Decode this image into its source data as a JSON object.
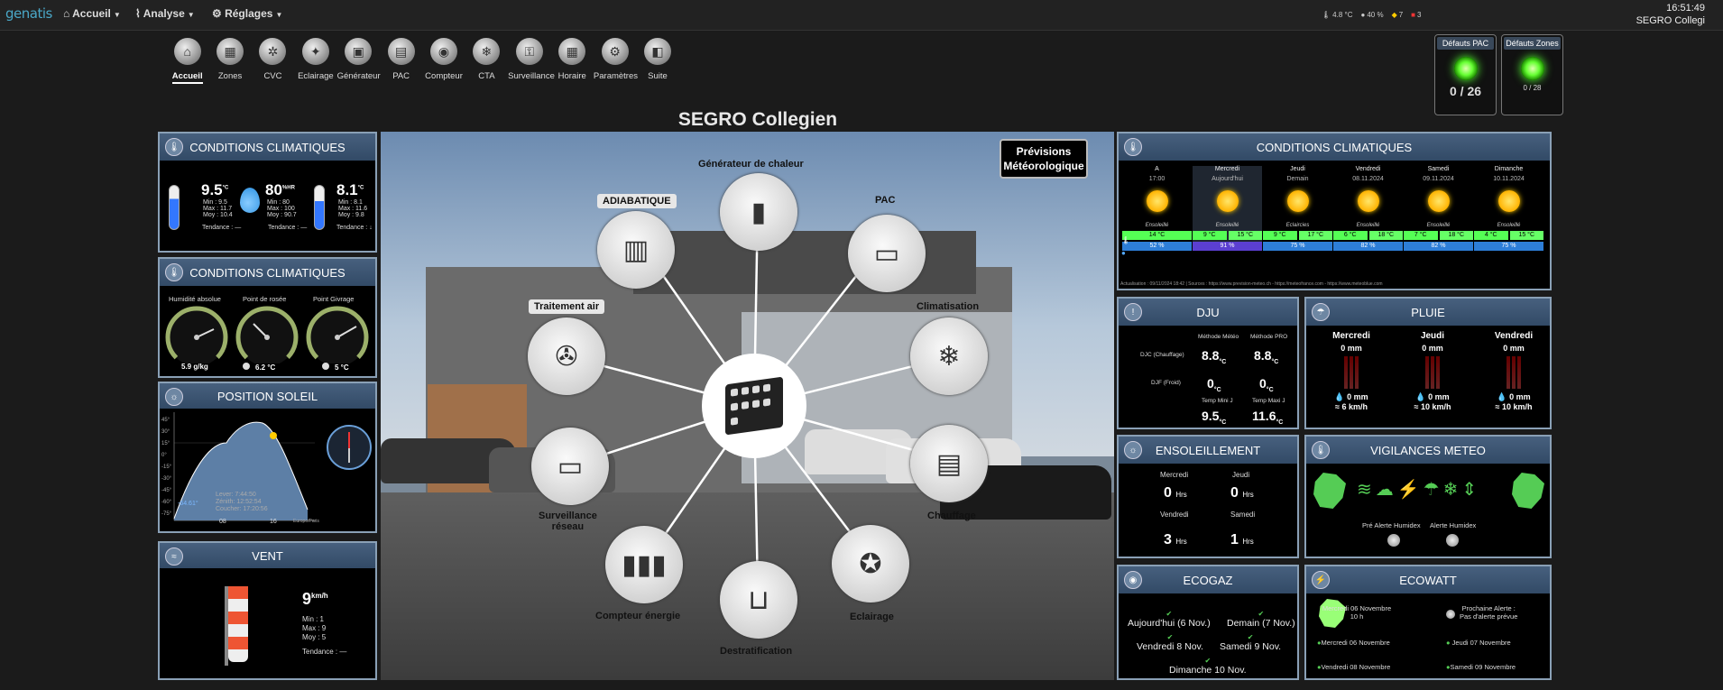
{
  "nav": {
    "logo": "genatis",
    "menu_accueil": "Accueil",
    "menu_analyse": "Analyse",
    "menu_reglages": "Réglages",
    "status_temp": "4.8 °C",
    "status_hum": "40 %",
    "status_alert": "7",
    "status_alarm": "3",
    "time": "16:51:49",
    "site": "SEGRO Collegi"
  },
  "toolbar": [
    {
      "label": "Accueil",
      "icon": "home-icon",
      "glyph": "⌂",
      "active": true
    },
    {
      "label": "Zones",
      "icon": "zones-icon",
      "glyph": "▦"
    },
    {
      "label": "CVC",
      "icon": "hvac-icon",
      "glyph": "✲"
    },
    {
      "label": "Eclairage",
      "icon": "bulb-icon",
      "glyph": "✦"
    },
    {
      "label": "Générateur",
      "icon": "generator-icon",
      "glyph": "▣"
    },
    {
      "label": "PAC",
      "icon": "heatpump-icon",
      "glyph": "▤"
    },
    {
      "label": "Compteur",
      "icon": "meter-icon",
      "glyph": "◉"
    },
    {
      "label": "CTA",
      "icon": "snowflake-icon",
      "glyph": "❄"
    },
    {
      "label": "Surveillance",
      "icon": "lock-icon",
      "glyph": "⚿"
    },
    {
      "label": "Horaire",
      "icon": "calendar-icon",
      "glyph": "▦"
    },
    {
      "label": "Paramètres",
      "icon": "gears-icon",
      "glyph": "⚙"
    },
    {
      "label": "Suite",
      "icon": "box-icon",
      "glyph": "◧"
    }
  ],
  "alarms": {
    "pac_title": "Défauts PAC",
    "pac_value": "0 / 26",
    "zones_title": "Défauts Zones",
    "zones_value": "0 / 28"
  },
  "page_title": "SEGRO Collegien",
  "climate1": {
    "title": "CONDITIONS CLIMATIQUES",
    "temp_in": "9.5",
    "temp_in_unit": "°C",
    "temp_in_min": "Min : 9.5",
    "temp_in_max": "Max : 11.7",
    "temp_in_moy": "Moy : 10.4",
    "hum": "80",
    "hum_unit": "%HR",
    "hum_min": "Min : 80",
    "hum_max": "Max : 100",
    "hum_moy": "Moy : 90.7",
    "temp_out": "8.1",
    "temp_out_unit": "°C",
    "temp_out_min": "Min : 8.1",
    "temp_out_max": "Max : 11.6",
    "temp_out_moy": "Moy : 9.8",
    "trend_in": "Tendance : —",
    "trend_hum": "Tendance : —",
    "trend_out": "Tendance : ↓"
  },
  "climate2": {
    "title": "CONDITIONS CLIMATIQUES",
    "g1_label": "Humidité absolue",
    "g1_value": "5.9 g/kg",
    "g2_label": "Point de rosée",
    "g2_value": "6.2 °C",
    "g3_label": "Point Givrage",
    "g3_value": "5 °C"
  },
  "sun": {
    "title": "POSITION SOLEIL",
    "lever": "Lever: 7:44:50",
    "zenith": "Zénith: 12:52:54",
    "coucher": "Coucher: 17:20:56",
    "angle": "-64.61°",
    "x1": "08",
    "x2": "16",
    "tz": "Europe/Paris",
    "y_labels": [
      "45°",
      "30°",
      "15°",
      "0°",
      "-15°",
      "-30°",
      "-45°",
      "-60°",
      "-75°"
    ]
  },
  "wind": {
    "title": "VENT",
    "speed": "9",
    "unit": "km/h",
    "min": "Min : 1",
    "max": "Max : 9",
    "moy": "Moy : 5",
    "trend": "Tendance : —"
  },
  "hero": {
    "forecast_label_1": "Prévisions",
    "forecast_label_2": "Météorologique",
    "nodes": {
      "generateur": "Générateur de chaleur",
      "adiabatique": "ADIABATIQUE",
      "pac": "PAC",
      "traitement": "Traitement air",
      "climatisation": "Climatisation",
      "chauffage": "Chauffage",
      "surveillance1": "Surveillance",
      "surveillance2": "réseau",
      "compteur": "Compteur énergie",
      "destrat": "Destratification",
      "eclairage": "Eclairage"
    }
  },
  "forecast": {
    "title": "CONDITIONS CLIMATIQUES",
    "source": "Actualisation : 09/11/2024 18:42 | Sources : https://www.prevision-meteo.ch - https://meteofrance.com - https://www.meteoblue.com",
    "days": [
      {
        "day": "A",
        "sub": "17:00",
        "desc": "Ensoleillé",
        "tmin": "14 °C",
        "tmax": "",
        "hum": "52 %",
        "wide": true
      },
      {
        "day": "Mercredi",
        "sub": "Aujourd'hui",
        "desc": "Ensoleillé",
        "tmin": "9 °C",
        "tmax": "15 °C",
        "hum": "91 %",
        "selected": true
      },
      {
        "day": "Jeudi",
        "sub": "Demain",
        "desc": "Eclaircies",
        "tmin": "9 °C",
        "tmax": "17 °C",
        "hum": "75 %"
      },
      {
        "day": "Vendredi",
        "sub": "08.11.2024",
        "desc": "Ensoleillé",
        "tmin": "6 °C",
        "tmax": "18 °C",
        "hum": "82 %"
      },
      {
        "day": "Samedi",
        "sub": "09.11.2024",
        "desc": "Ensoleillé",
        "tmin": "7 °C",
        "tmax": "18 °C",
        "hum": "82 %"
      },
      {
        "day": "Dimanche",
        "sub": "10.11.2024",
        "desc": "Ensoleillé",
        "tmin": "4 °C",
        "tmax": "15 °C",
        "hum": "75 %"
      }
    ]
  },
  "dju": {
    "title": "DJU",
    "col1": "Méthode Météo",
    "col2": "Méthode PRO",
    "row1": "DJC (Chauffage)",
    "row1_v1": "8.8",
    "row1_v2": "8.8",
    "row2": "DJF (Froid)",
    "row2_v1": "0",
    "row2_v2": "0",
    "unit": "°C",
    "tmin_label": "Temp Mini J",
    "tmin": "9.5",
    "tmax_label": "Temp Maxi J",
    "tmax": "11.6"
  },
  "pluie": {
    "title": "PLUIE",
    "days": [
      {
        "day": "Mercredi",
        "mm": "0 mm",
        "rain": "0 mm",
        "wind": "6 km/h"
      },
      {
        "day": "Jeudi",
        "mm": "0 mm",
        "rain": "0 mm",
        "wind": "10 km/h"
      },
      {
        "day": "Vendredi",
        "mm": "0 mm",
        "rain": "0 mm",
        "wind": "10 km/h"
      }
    ]
  },
  "ensoleillement": {
    "title": "ENSOLEILLEMENT",
    "d1": "Mercredi",
    "v1": "0",
    "d2": "Jeudi",
    "v2": "0",
    "d3": "Vendredi",
    "v3": "3",
    "d4": "Samedi",
    "v4": "1",
    "unit": "Hrs"
  },
  "vigilances": {
    "title": "VIGILANCES METEO",
    "pre": "Pré Alerte Humidex",
    "alerte": "Alerte Humidex"
  },
  "ecogaz": {
    "title": "ECOGAZ",
    "d1": "Aujourd'hui (6 Nov.)",
    "d2": "Demain (7 Nov.)",
    "d3": "Vendredi 8 Nov.",
    "d4": "Samedi 9 Nov.",
    "d5": "Dimanche 10 Nov."
  },
  "ecowatt": {
    "title": "ECOWATT",
    "current_1": "Mercredi 06 Novembre",
    "current_2": "10 h",
    "next_1": "Prochaine Alerte :",
    "next_2": "Pas d'alerte prévue",
    "d1": "Mercredi 06 Novembre",
    "d2": "Jeudi 07 Novembre",
    "d3": "Vendredi 08 Novembre",
    "d4": "Samedi 09 Novembre"
  },
  "colors": {
    "accent": "#324a66",
    "ok_green": "#5fdc2a",
    "panel_border": "#8aa0b6",
    "temp_green": "#66ff66",
    "humidity_blue": "#2d7ed8"
  }
}
